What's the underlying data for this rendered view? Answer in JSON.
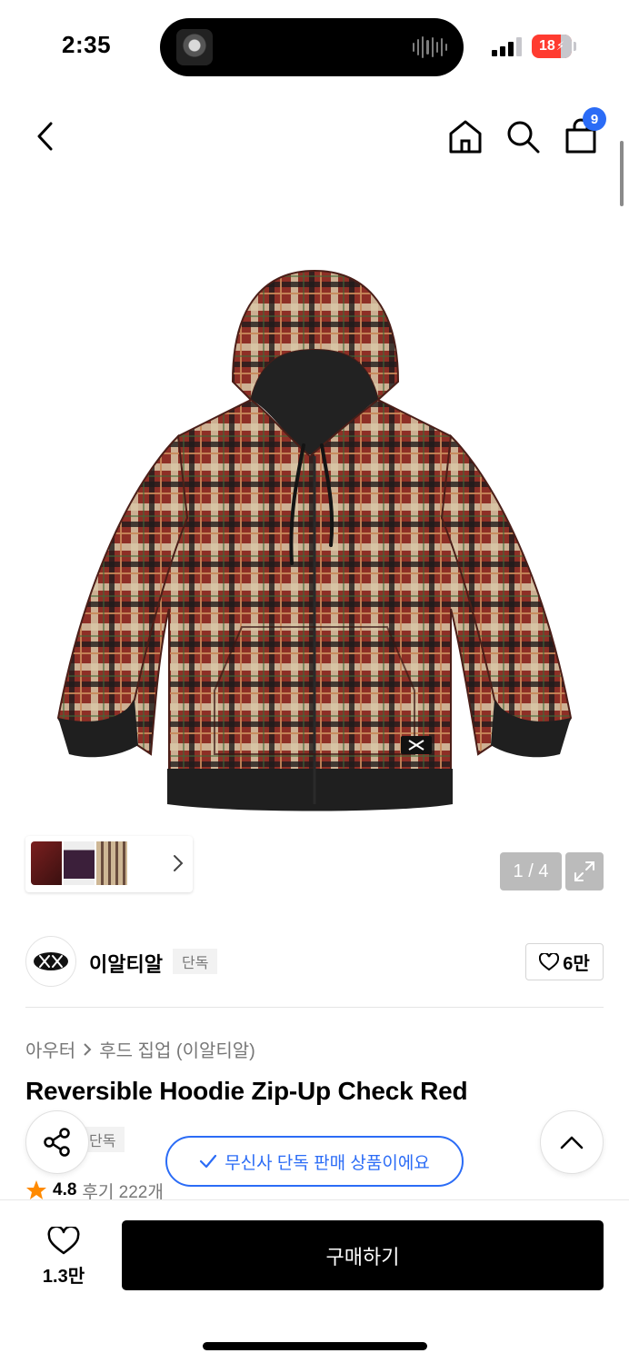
{
  "status_bar": {
    "time": "2:35",
    "battery": "18"
  },
  "nav": {
    "back_icon": "chevron-left-icon",
    "home_icon": "home-icon",
    "search_icon": "search-icon",
    "cart_icon": "shopping-bag-icon",
    "cart_count": "9"
  },
  "gallery": {
    "counter": "1 / 4",
    "current_image": 1,
    "total_images": 4,
    "thumbnail_count": 3
  },
  "brand": {
    "name": "이알티알",
    "exclusive_tag": "단독",
    "likes": "6만"
  },
  "breadcrumb": {
    "category": "아우터",
    "subcategory": "후드 집업 (이알티알)"
  },
  "product": {
    "title": "Reversible Hoodie Zip-Up Check Red",
    "tag": "단독",
    "rating": "4.8",
    "reviews": "후기 222개"
  },
  "toast": {
    "text": "무신사 단독 판매 상품이에요"
  },
  "bottom": {
    "wish_count": "1.3만",
    "buy_label": "구매하기"
  },
  "colors": {
    "accent_blue": "#2b6cf6",
    "star": "#ff8a00",
    "plaid_red": "#8e2f26",
    "plaid_cream": "#d8c7a6",
    "plaid_dark": "#1f1c1b"
  }
}
